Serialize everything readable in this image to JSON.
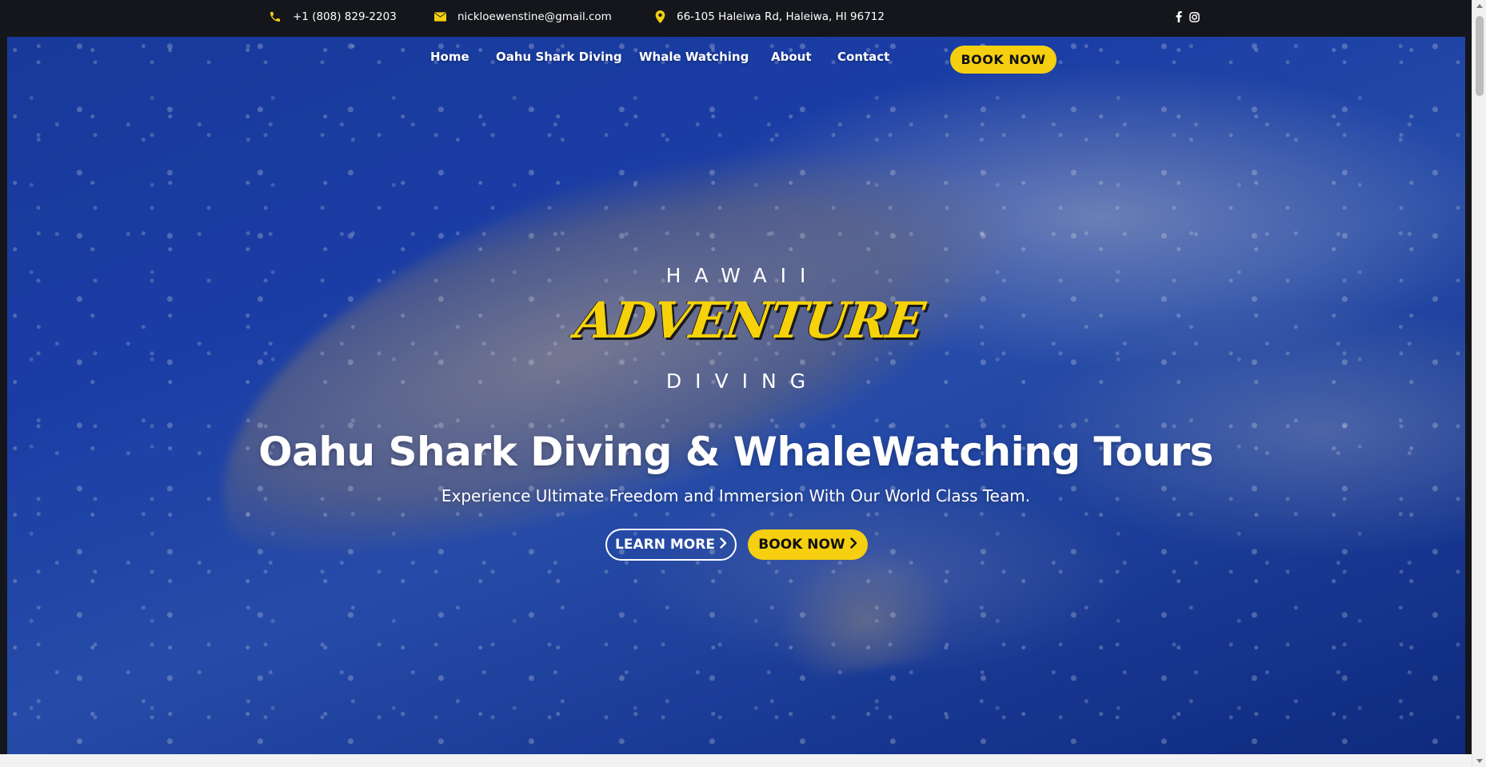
{
  "topbar": {
    "phone": "+1 (808) 829-2203",
    "email": "nickloewenstine@gmail.com",
    "address": "66-105 Haleiwa Rd, Haleiwa, HI 96712",
    "icon_color": "#f5cf10"
  },
  "social": {
    "facebook_icon": "facebook-icon",
    "instagram_icon": "instagram-icon"
  },
  "nav": {
    "items": [
      "Home",
      "Oahu Shark Diving",
      "Whale Watching",
      "About",
      "Contact"
    ],
    "book_label": "BOOK NOW"
  },
  "logo": {
    "top": "HAWAII",
    "main": "ADVENTURE",
    "bottom": "DIVING"
  },
  "hero": {
    "headline": "Oahu Shark Diving & WhaleWatching Tours",
    "subheadline": "Experience Ultimate Freedom and Immersion With Our World Class Team.",
    "learn_more_label": "LEARN MORE",
    "book_now_label": "BOOK NOW"
  },
  "colors": {
    "accent": "#f5cf10",
    "topbar_bg": "#14161b",
    "ocean": "#1d44b4"
  }
}
